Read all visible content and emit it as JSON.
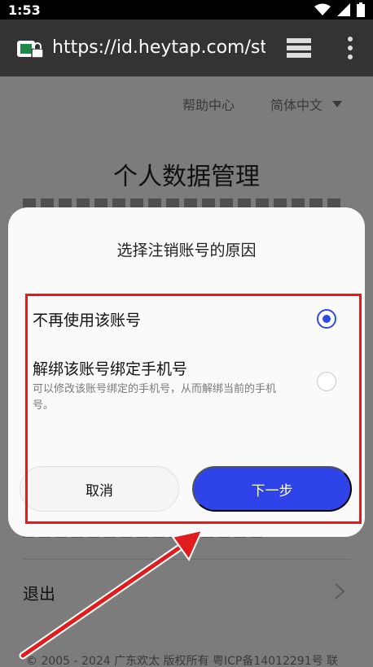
{
  "status_bar": {
    "time": "1:53"
  },
  "browser": {
    "url": "https://id.heytap.com/sta"
  },
  "page": {
    "help_link": "帮助中心",
    "language": "简体中文",
    "title": "个人数据管理",
    "logout_label": "退出",
    "footer": "© 2005 - 2024 广东欢太 版权所有 粤ICP备14012291号 联"
  },
  "dialog": {
    "title": "选择注销账号的原因",
    "options": [
      {
        "label": "不再使用该账号",
        "description": "",
        "selected": true
      },
      {
        "label": "解绑该账号绑定手机号",
        "description": "可以修改该账号绑定的手机号，从而解绑当前的手机号。",
        "selected": false
      }
    ],
    "cancel_label": "取消",
    "next_label": "下一步"
  },
  "colors": {
    "accent": "#2f44e8",
    "annotation": "#e01c1c",
    "toolbar": "#333333"
  }
}
